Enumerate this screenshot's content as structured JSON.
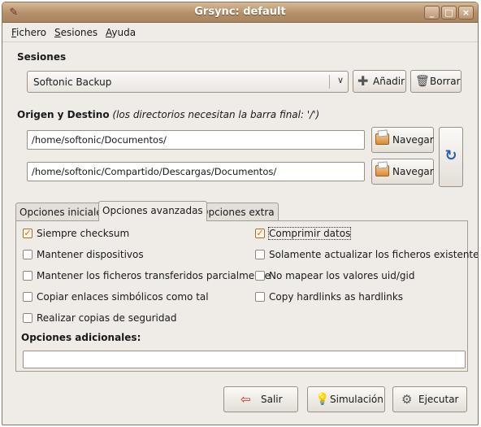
{
  "window": {
    "title": "Grsync: default"
  },
  "menu": [
    "Fichero",
    "Sesiones",
    "Ayuda"
  ],
  "sessions": {
    "heading": "Sesiones",
    "selected": "Softonic Backup",
    "add_label": "Añadir",
    "delete_label": "Borrar"
  },
  "paths": {
    "heading": "Origen y Destino",
    "heading_note": "(los directorios necesitan la barra final: '/')",
    "source": "/home/softonic/Documentos/",
    "destination": "/home/softonic/Compartido/Descargas/Documentos/",
    "browse_label": "Navegar"
  },
  "tabs": [
    "Opciones iniciales",
    "Opciones avanzadas",
    "Opciones extra"
  ],
  "active_tab": "Opciones avanzadas",
  "options_left": [
    {
      "label": "Siempre checksum",
      "checked": true
    },
    {
      "label": "Mantener dispositivos",
      "checked": false
    },
    {
      "label": "Mantener los ficheros transferidos parcialmente",
      "checked": false
    },
    {
      "label": "Copiar enlaces simbólicos como tal",
      "checked": false
    },
    {
      "label": "Realizar copias de seguridad",
      "checked": false
    }
  ],
  "options_right": [
    {
      "label": "Comprimir datos",
      "checked": true
    },
    {
      "label": "Solamente actualizar los ficheros existentes",
      "checked": false
    },
    {
      "label": "No mapear los valores uid/gid",
      "checked": false
    },
    {
      "label": "Copy hardlinks as hardlinks",
      "checked": false
    }
  ],
  "additional": {
    "label": "Opciones adicionales:",
    "value": ""
  },
  "actions": {
    "quit_label": "Salir",
    "simulate_label": "Simulación",
    "run_label": "Ejecutar"
  },
  "colors": {
    "titlebar": "#b4906a",
    "window_bg": "#efebe7",
    "check_mark": "#d96c0f"
  }
}
